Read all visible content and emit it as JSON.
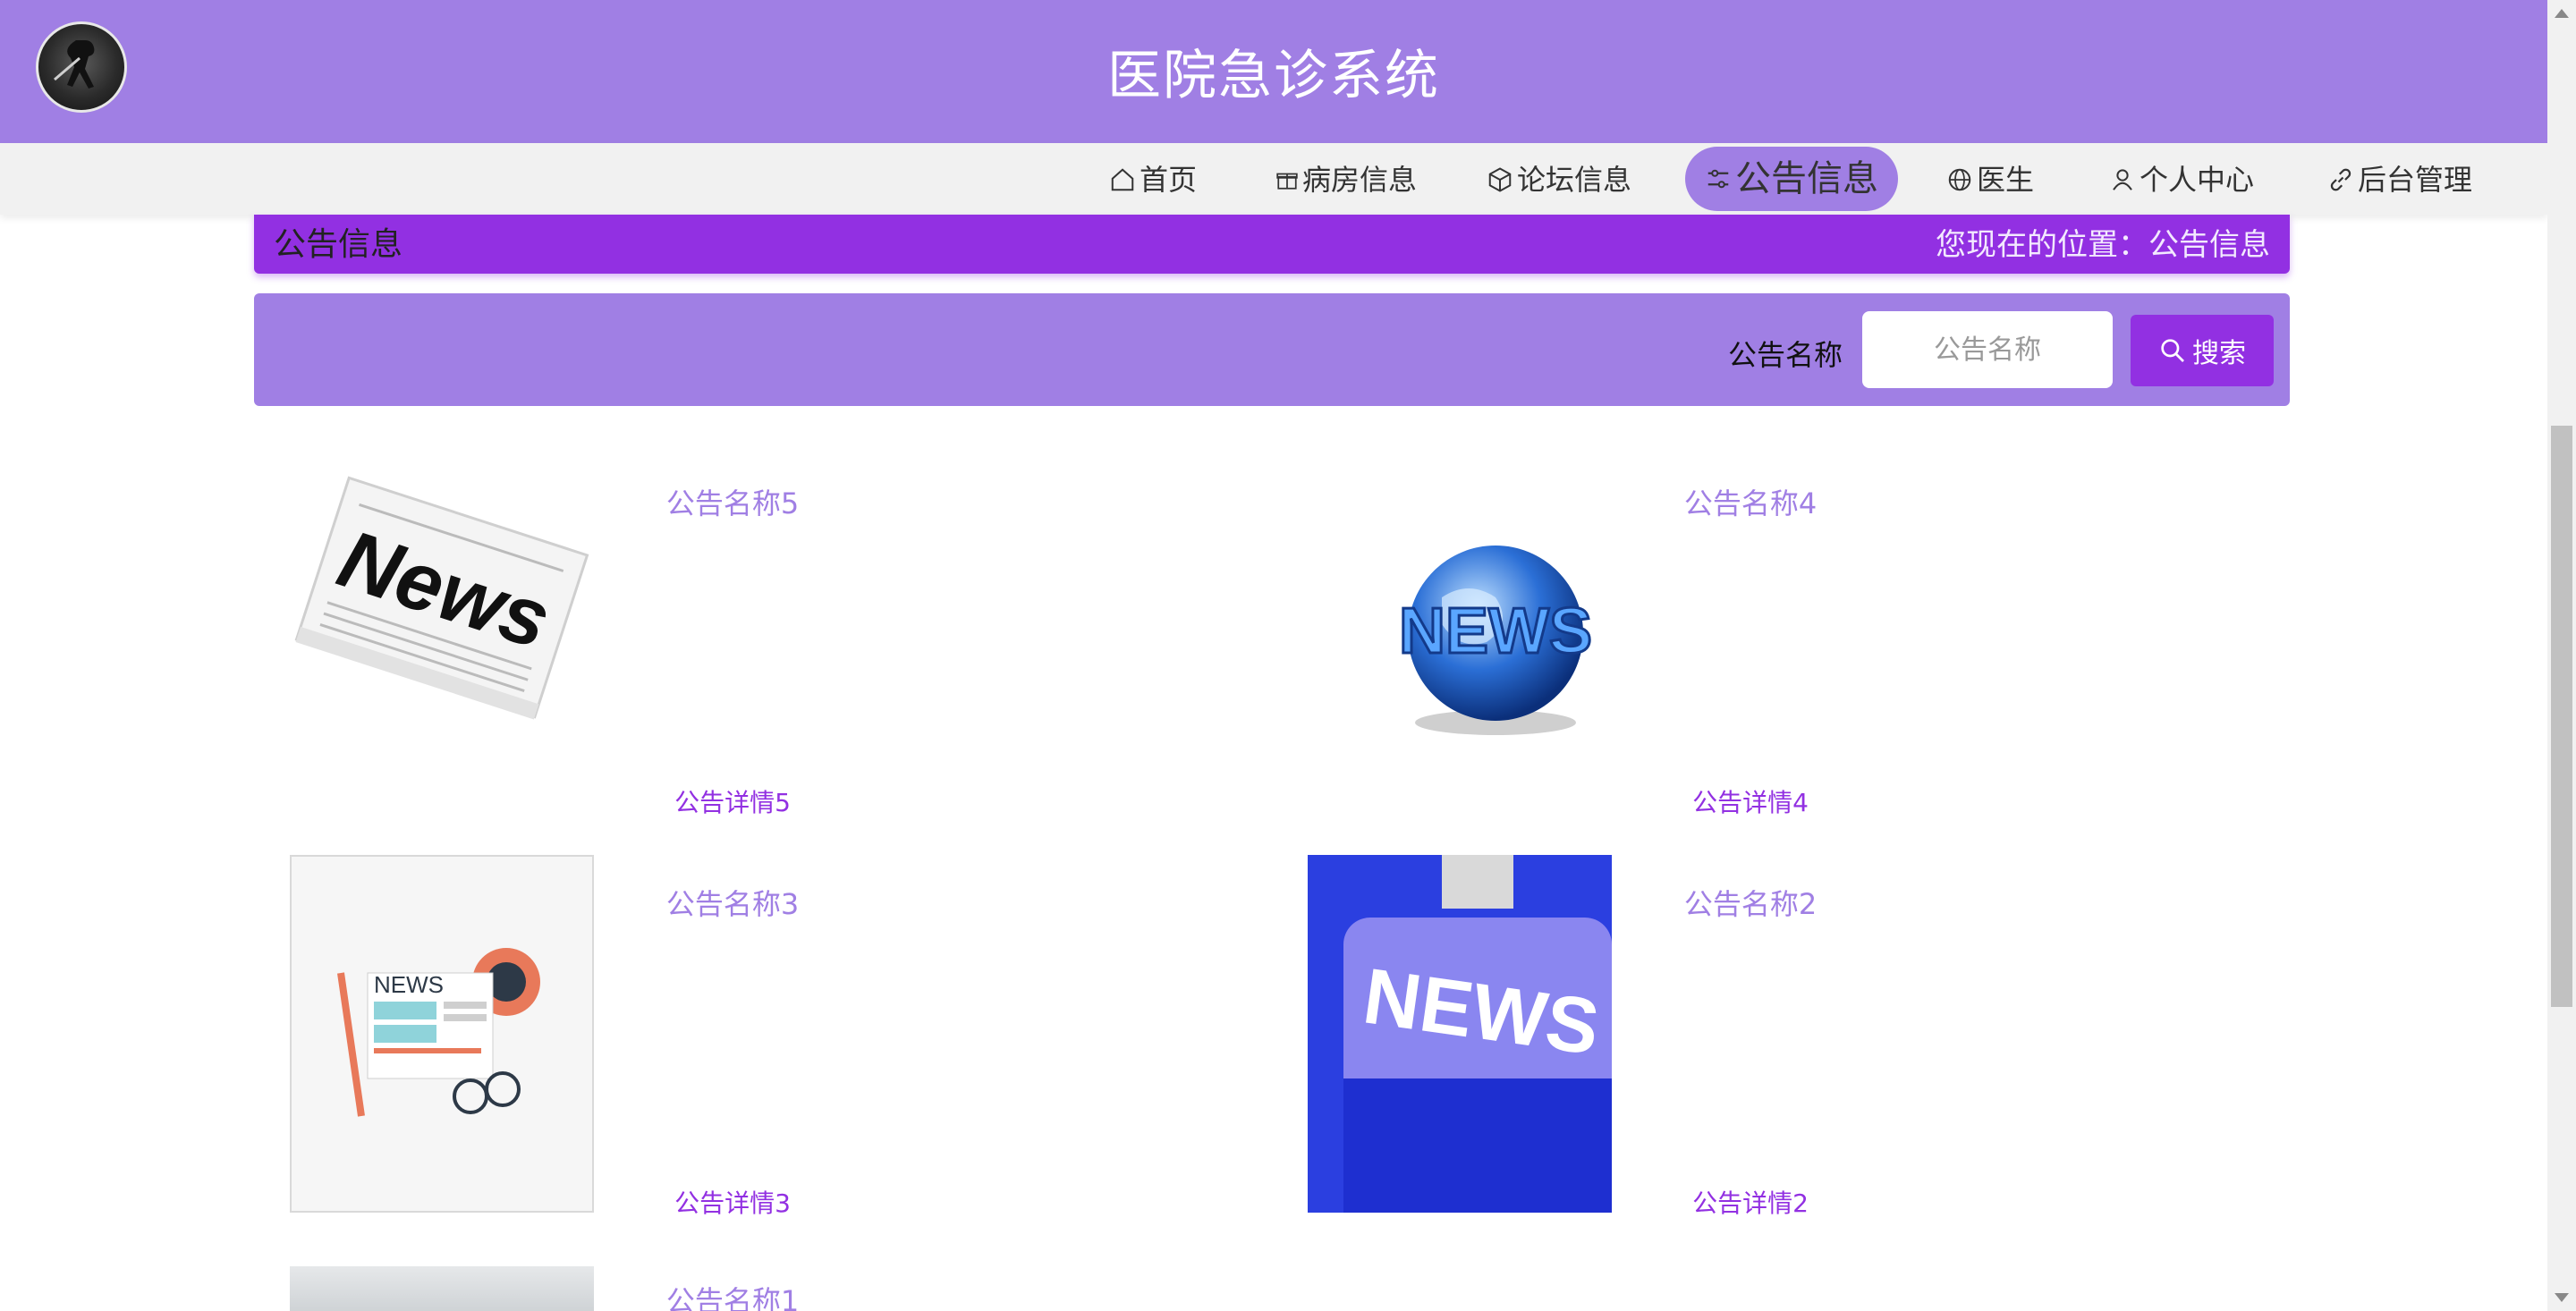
{
  "site": {
    "title": "医院急诊系统"
  },
  "nav": {
    "items": [
      {
        "label": "首页",
        "icon": "home-icon"
      },
      {
        "label": "病房信息",
        "icon": "gift-icon"
      },
      {
        "label": "论坛信息",
        "icon": "box-icon"
      },
      {
        "label": "公告信息",
        "icon": "sliders-icon",
        "active": true
      },
      {
        "label": "医生",
        "icon": "globe-icon"
      },
      {
        "label": "个人中心",
        "icon": "user-icon"
      },
      {
        "label": "后台管理",
        "icon": "link-icon"
      }
    ]
  },
  "titlebar": {
    "title": "公告信息",
    "breadcrumb": "您现在的位置：公告信息"
  },
  "search": {
    "label": "公告名称",
    "placeholder": "公告名称",
    "button": "搜索"
  },
  "announcements": [
    {
      "name": "公告名称5",
      "detail": "公告详情5",
      "image": "news-newspaper"
    },
    {
      "name": "公告名称4",
      "detail": "公告详情4",
      "image": "news-globe"
    },
    {
      "name": "公告名称3",
      "detail": "公告详情3",
      "image": "news-flat-illustration"
    },
    {
      "name": "公告名称2",
      "detail": "公告详情2",
      "image": "news-keyboard-key"
    },
    {
      "name": "公告名称1",
      "detail": "",
      "image": "news-photo"
    }
  ],
  "colors": {
    "header": "#a07fe4",
    "accent": "#9230e2",
    "nav_bg": "#f1f1f1"
  }
}
